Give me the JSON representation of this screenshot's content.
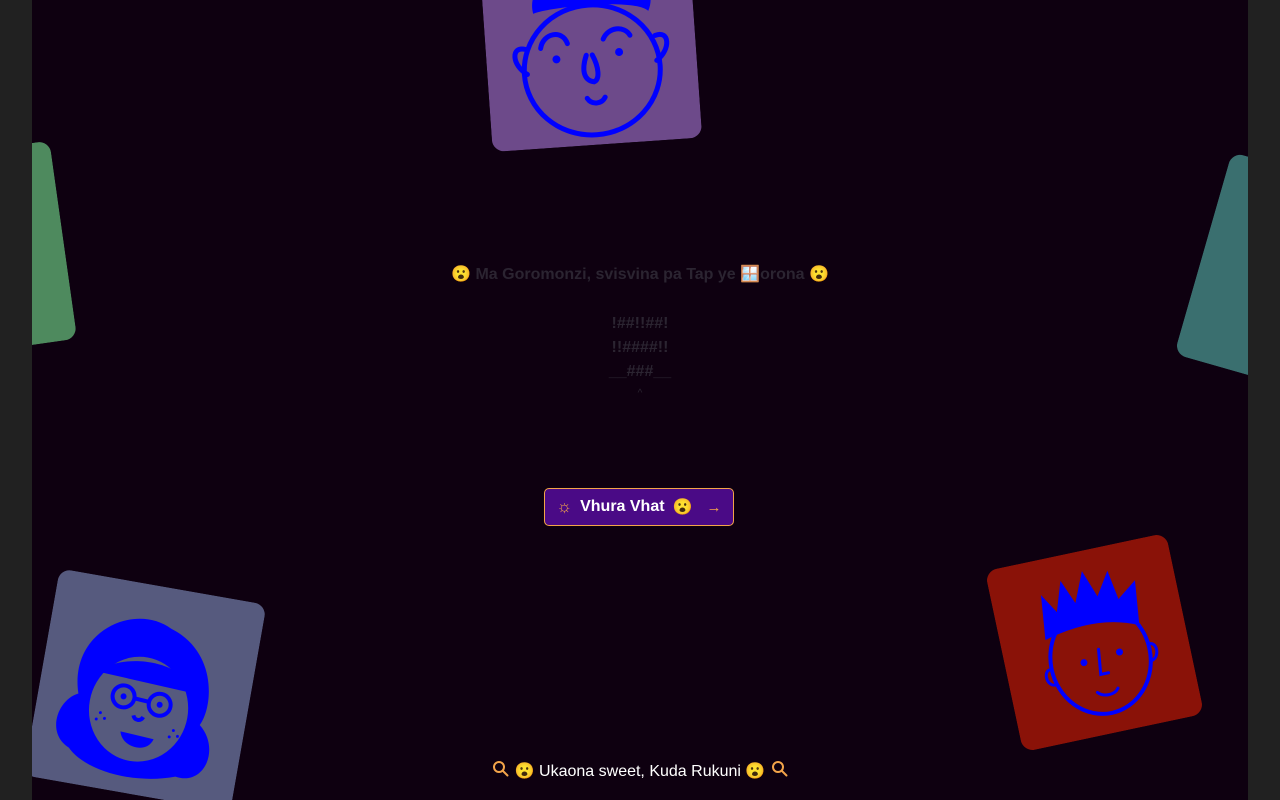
{
  "tagline": "😮 Ma Goromonzi, svisvina pa Tap ye 🪟orona 😮",
  "ascii": {
    "line1": "!##!!##!",
    "line2": "!!####!!",
    "line3": "__###__",
    "caret": "^"
  },
  "cta": {
    "icon": "sun-icon",
    "label": "Vhura Vhat",
    "emoji": "😮",
    "arrow": "→"
  },
  "footer": {
    "icon": "magnifier-icon",
    "text": "😮 Ukaona sweet, Kuda Rukuni 😮"
  },
  "colors": {
    "page_bg": "#0e0010",
    "outer_bg": "#212121",
    "button_bg": "#4a0a86",
    "accent": "#f3a44a",
    "face_stroke": "#0000ff",
    "card_top": "#6d4a8a",
    "card_left": "#4e8a5e",
    "card_right": "#3a6f6f",
    "card_bottom_left": "#565a7e",
    "card_bottom_right": "#8a1208"
  },
  "cards": [
    {
      "name": "avatar-card-top",
      "icon": "face-curly-hair-icon"
    },
    {
      "name": "avatar-card-left",
      "icon": "partial-card"
    },
    {
      "name": "avatar-card-right",
      "icon": "partial-card"
    },
    {
      "name": "avatar-card-bottom-left",
      "icon": "face-glasses-icon"
    },
    {
      "name": "avatar-card-bottom-right",
      "icon": "face-spiky-hair-icon"
    }
  ]
}
